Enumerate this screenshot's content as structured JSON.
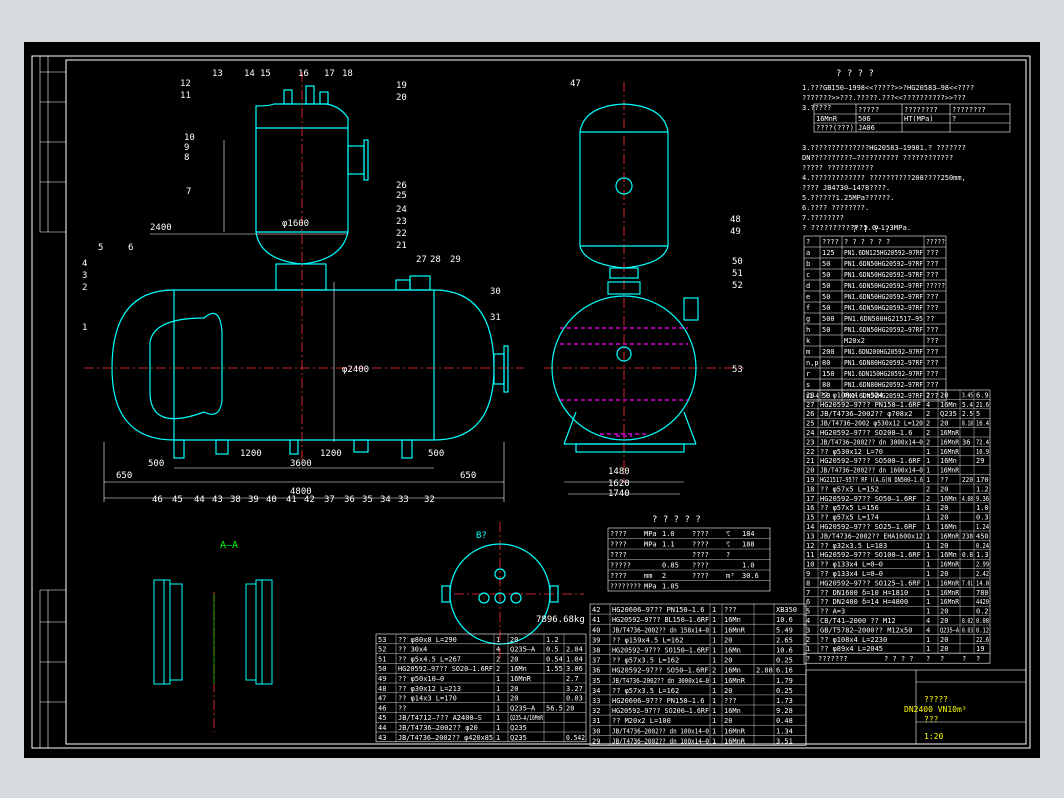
{
  "drawing": {
    "title_line1": "?????",
    "title_line2": "DN2400 VN10m³",
    "title_line3": "???",
    "weight": "7896.68kg",
    "section_label": "A–A",
    "view_label": "B?",
    "scale": "1:20"
  },
  "notes": {
    "heading": "? ? ? ?",
    "lines": [
      "1.???GB150—1998<<?????>>?HG20583—98<<????",
      "???????>>???.?????.???<<??????????>>???",
      "3.?????",
      "3.??????????????HG20583—19981.? ???????",
      "DN??????????—?????????? ????????????",
      "????? ???????????",
      "4.????????????? ??????????208????250mm,",
      "???? JB4730—1478????.",
      "5.??????1.25MPa??????.",
      "6.???? ????????.",
      "7.????????",
      "?  ????????????1.0—1.3MPa."
    ]
  },
  "design_table": {
    "headers": [
      "",
      "?????",
      "????????",
      "????????"
    ],
    "rows": [
      [
        "16MnR",
        "506",
        "HT(MPa)",
        "?"
      ],
      [
        "????(???)",
        "JA06",
        "",
        ""
      ]
    ]
  },
  "nozzle_table": {
    "heading": "? ? ? ?",
    "columns": [
      "?",
      "????",
      "? ? ? ? ? ?",
      "?????"
    ],
    "rows": [
      [
        "a",
        "125",
        "PN1.6DN125HG20592—97RF",
        "???"
      ],
      [
        "b",
        "50",
        "PN1.6DN50HG20592—97RF",
        "???"
      ],
      [
        "c",
        "50",
        "PN1.6DN50HG20592—97RF",
        "???"
      ],
      [
        "d",
        "50",
        "PN1.6DN50HG20592—97RF",
        "?????"
      ],
      [
        "e",
        "50",
        "PN1.6DN50HG20592—97RF",
        "???"
      ],
      [
        "f",
        "50",
        "PN1.6DN50HG20592—97RF",
        "???"
      ],
      [
        "g",
        "500",
        "PN1.6DN500HG21517—95",
        "??"
      ],
      [
        "h",
        "50",
        "PN1.6DN50HG20592—97RF",
        "???"
      ],
      [
        "k",
        "",
        "M20x2",
        "???"
      ],
      [
        "m",
        "200",
        "PN1.6DN200HG20592—97RF",
        "???"
      ],
      [
        "n,p",
        "80",
        "PN1.6DN80HG20592—97RF",
        "???"
      ],
      [
        "r",
        "150",
        "PN1.6DN150HG20592—97RF",
        "???"
      ],
      [
        "s",
        "80",
        "PN1.6DN80HG20592—97RF",
        "???"
      ],
      [
        "s1–4",
        "50",
        "PN1.6DN50HG20592—97RF",
        "???"
      ]
    ]
  },
  "spec_table": {
    "heading": "? ? ? ? ?",
    "rows": [
      [
        "????",
        "MPa",
        "1.0",
        "????",
        "℃",
        "184"
      ],
      [
        "????",
        "MPa",
        "1.1",
        "????",
        "℃",
        "188"
      ],
      [
        "????",
        "",
        "",
        "????",
        "?",
        ""
      ],
      [
        "?????",
        "",
        "0.85",
        "????",
        "",
        "1.0"
      ],
      [
        "????",
        "mm",
        "2",
        "????",
        "m³",
        "30.6"
      ],
      [
        "????????",
        "MPa",
        "1.05",
        "",
        "",
        ""
      ]
    ]
  },
  "bom_right": {
    "rows": [
      [
        "28",
        "?? φ108x4 L=324",
        "2",
        "20",
        "3.45",
        "6.9"
      ],
      [
        "27",
        "HG20592—97?? PN150—1.6RF",
        "4",
        "16Mn",
        "5.4",
        "21.6"
      ],
      [
        "26",
        "JB/T4736—2002?? φ708x2",
        "2",
        "Q235",
        "2.5",
        "5"
      ],
      [
        "25",
        "JB/T4736—2002 φ530x12 L=120",
        "2",
        "20",
        "8.18",
        "16.4"
      ],
      [
        "24",
        "HG20592—97?? SO200—1.6",
        "2",
        "16MnR",
        "",
        ""
      ],
      [
        "23",
        "JB/T4736—2002?? dn 3000x14—0",
        "2",
        "16MnR",
        "36",
        "72.4"
      ],
      [
        "22",
        "?? φ530x12 L=70",
        "1",
        "16MnR",
        "",
        "10.9"
      ],
      [
        "21",
        "HG20592—97?? SO500—1.6RF",
        "1",
        "16Mn",
        "",
        "29"
      ],
      [
        "20",
        "JB/T4736—2002?? dn 1600x14—0",
        "1",
        "16MnR",
        "",
        ""
      ],
      [
        "19",
        "HG21517—95?? RF Ⅰ(A.G)N DN500—1.6",
        "1",
        "??",
        "220",
        "170"
      ],
      [
        "18",
        "?? φ57x5 L=152",
        "2",
        "20",
        "",
        "1.2"
      ],
      [
        "17",
        "HG20592—97?? SO50—1.6RF",
        "2",
        "16Mn",
        "4.68",
        "9.36"
      ],
      [
        "16",
        "?? φ57x5 L=156",
        "1",
        "20",
        "",
        "1.0"
      ],
      [
        "15",
        "?? φ57x5 L=174",
        "1",
        "20",
        "",
        "0.3"
      ],
      [
        "14",
        "HG20592—97?? SO25—1.6RF",
        "1",
        "16Mn",
        "",
        "1.24"
      ],
      [
        "13",
        "JB/T4736—2002?? EHA1600x12",
        "1",
        "16MnR",
        "238",
        "450"
      ],
      [
        "12",
        "?? φ32x3.5 L=183",
        "1",
        "20",
        "",
        "0.24"
      ],
      [
        "11",
        "HG20592—97?? SO100—1.6RF",
        "1",
        "16Mn",
        "0.8",
        "1.3"
      ],
      [
        "10",
        "?? φ133x4 L=0—0",
        "1",
        "16MnR",
        "",
        "2.99"
      ],
      [
        "9",
        "?? φ133x4 L=0—0",
        "1",
        "20",
        "",
        "2.42"
      ],
      [
        "8",
        "HG20592—97?? SO125—1.6RF",
        "1",
        "16MnR",
        "7.01",
        "14.0"
      ],
      [
        "7",
        "?? DN1600 δ=10 H=1810",
        "1",
        "16MnR",
        "",
        "780"
      ],
      [
        "6",
        "?? DN2400 δ=14 H=4800",
        "1",
        "16MnR",
        "",
        "4420"
      ],
      [
        "5",
        "?? A=3",
        "1",
        "20",
        "",
        "0.2"
      ],
      [
        "4",
        "CB/T41—2000 ?? M12",
        "4",
        "20",
        "0.02",
        "0.08"
      ],
      [
        "3",
        "GB/T5782—2000?? M12x50",
        "4",
        "Q235—A",
        "0.03",
        "0.12"
      ],
      [
        "2",
        "?? φ108x4 L=2230",
        "1",
        "20",
        "",
        "22.6"
      ],
      [
        "1",
        "?? φ89x4 L=2045",
        "1",
        "20",
        "",
        "19"
      ]
    ],
    "header": [
      "?",
      "???????",
      "? ? ? ?",
      "?",
      "?",
      "?",
      "?"
    ]
  },
  "bom_bottom_left": {
    "rows": [
      [
        "53",
        "?? φ80x8 L=290",
        "1",
        "20",
        "1.2",
        ""
      ],
      [
        "52",
        "?? 30x4",
        "4",
        "Q235—A",
        "0.5",
        "2.04"
      ],
      [
        "51",
        "?? φ5x4.5 L=267",
        "2",
        "20",
        "0.54",
        "1.04"
      ],
      [
        "50",
        "HG20592—97?? SO20—1.6RF",
        "2",
        "16Mn",
        "1.55",
        "3.06"
      ],
      [
        "49",
        "?? φ50x10—0",
        "1",
        "16MnR",
        "",
        "2.7"
      ],
      [
        "48",
        "?? φ30x12 L=213",
        "1",
        "20",
        "",
        "3.27"
      ],
      [
        "47",
        "?? φ14x3 L=170",
        "1",
        "20",
        "",
        "0.03"
      ],
      [
        "46",
        "??",
        "1",
        "Q235—A",
        "56.5",
        "20"
      ],
      [
        "45",
        "JB/T4712—??? A2400—S",
        "1",
        "Q235—A/16MnR",
        "",
        ""
      ],
      [
        "44",
        "JB/T4736—2002?? φ20",
        "1",
        "Q235",
        "",
        ""
      ],
      [
        "43",
        "JB/T4736—2002?? φ420x85",
        "1",
        "Q235",
        "",
        "0.542"
      ]
    ]
  },
  "bom_bottom_mid": {
    "rows": [
      [
        "42",
        "HG20606—97?? PN150—1.6",
        "1",
        "???",
        "",
        "XB350"
      ],
      [
        "41",
        "HG20592—97?? BL150—1.6RF",
        "1",
        "16Mn",
        "",
        "10.6"
      ],
      [
        "40",
        "JB/T4736—2002?? dn 158x14—0",
        "1",
        "16MnR",
        "",
        "5.49"
      ],
      [
        "39",
        "?? φ159x4.5 L=162",
        "1",
        "20",
        "",
        "2.65"
      ],
      [
        "38",
        "HG20592—97?? SO150—1.6RF",
        "1",
        "16Mn",
        "",
        "10.6"
      ],
      [
        "37",
        "?? φ57x3.5 L=162",
        "1",
        "20",
        "",
        "0.25"
      ],
      [
        "36",
        "HG20592—97?? SO50—1.6RF",
        "2",
        "16Mn",
        "2.08",
        "6.16"
      ],
      [
        "35",
        "JB/T4736—2002?? dn 3000x14—0",
        "1",
        "16MnR",
        "",
        "1.79"
      ],
      [
        "34",
        "?? φ57x3.5 L=162",
        "1",
        "20",
        "",
        "0.25"
      ],
      [
        "33",
        "HG20606—97?? PN150—1.6",
        "1",
        "???",
        "",
        "1.73"
      ],
      [
        "32",
        "HG20592—97?? SO200—1.6RF",
        "1",
        "16Mn",
        "",
        "9.28"
      ],
      [
        "31",
        "?? M20x2 L=100",
        "1",
        "20",
        "",
        "0.48"
      ],
      [
        "30",
        "JB/T4736—2002?? dn 100x14—0",
        "1",
        "16MnR",
        "",
        "1.34"
      ],
      [
        "29",
        "JB/T4736—2002?? dn 100x14—0",
        "1",
        "16MnR",
        "",
        "3.51"
      ]
    ]
  },
  "part_numbers": {
    "top": [
      "13",
      "14",
      "15",
      "16",
      "17",
      "18",
      "12",
      "11",
      "10",
      "9",
      "8",
      "7",
      "19",
      "20"
    ],
    "bottom": [
      "46",
      "45",
      "44",
      "43",
      "38",
      "39",
      "40",
      "41",
      "42",
      "37",
      "36",
      "35",
      "34",
      "33",
      "32"
    ],
    "left": [
      "5",
      "6",
      "4",
      "3",
      "2",
      "1"
    ],
    "right": [
      "26",
      "25",
      "24",
      "23",
      "22",
      "21",
      "27",
      "28",
      "29",
      "30",
      "31"
    ],
    "side": [
      "47",
      "48",
      "49",
      "50",
      "51",
      "52",
      "53"
    ]
  },
  "dimensions": {
    "overall_length": "4800",
    "shell_length": "3600",
    "left_span": "650",
    "right_span": "650",
    "support_half_left": "500",
    "support_half_right": "500",
    "d1": "1200",
    "d2": "1200",
    "vessel_dia": "φ1600",
    "main_dia": "φ2400",
    "height": "2400",
    "side_total": "1740",
    "side_base": "1620",
    "side_mid": "1480"
  },
  "colors": {
    "outline": "#00ffff",
    "center": "#ff3333",
    "hidden": "#ff00ff",
    "text": "#ffffff",
    "frame": "#ffffff",
    "accent": "#00ff00"
  }
}
